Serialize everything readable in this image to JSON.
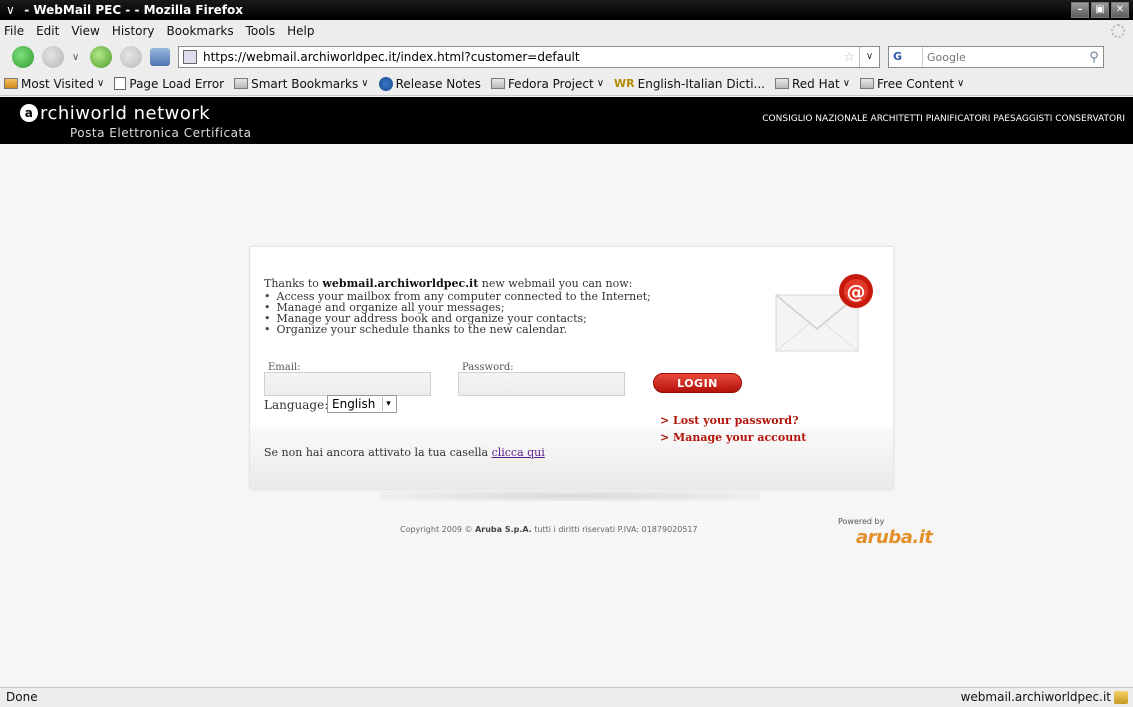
{
  "window": {
    "title": "- WebMail PEC - - Mozilla Firefox",
    "menu_glyph": "∨",
    "btn_min": "–",
    "btn_max": "▣",
    "btn_close": "✕"
  },
  "menubar": {
    "items": [
      "File",
      "Edit",
      "View",
      "History",
      "Bookmarks",
      "Tools",
      "Help"
    ]
  },
  "navbar": {
    "url": "https://webmail.archiworldpec.it/index.html?customer=default",
    "search_engine": "G",
    "search_placeholder": "Google",
    "drop_glyph": "∨",
    "star_glyph": "☆",
    "search_glyph": "⚲"
  },
  "bookmarks": {
    "items": [
      "Most Visited",
      "Page Load Error",
      "Smart Bookmarks",
      "Release Notes",
      "Fedora Project",
      "English-Italian Dicti...",
      "Red Hat",
      "Free Content"
    ],
    "chevron": "∨",
    "wr_glyph": "WR"
  },
  "header": {
    "logo_mark": "a",
    "logo_text": "rchiworld network",
    "tagline": "Posta Elettronica Certificata",
    "council": "CONSIGLIO NAZIONALE ARCHITETTI PIANIFICATORI PAESAGGISTI CONSERVATORI"
  },
  "login": {
    "intro_pre": "Thanks to ",
    "intro_site": "webmail.archiworldpec.it",
    "intro_post": " new webmail you can now:",
    "features": [
      "Access your mailbox from any computer connected to the Internet;",
      "Manage and organize all your messages;",
      "Manage your address book and organize your contacts;",
      "Organize your schedule thanks to the new calendar."
    ],
    "email_label": "Email:",
    "email_value": "",
    "password_label": "Password:",
    "password_value": "",
    "login_button": "LOGIN",
    "language_label": "Language:",
    "language_value": "English",
    "select_arrow": "▾",
    "lost_password": "> Lost your password?",
    "manage_account": "> Manage your account",
    "activate_text": "Se non hai ancora attivato la tua casella ",
    "activate_link": "clicca qui",
    "envelope_badge": "@"
  },
  "footer": {
    "copyright_pre": "Copyright 2009 © ",
    "copyright_company": "Aruba S.p.A.",
    "copyright_post": "  tutti i diritti riservati   P.IVA: 01879020517",
    "powered_by": "Powered by",
    "aruba_logo": "aruba.it"
  },
  "statusbar": {
    "status": "Done",
    "host": "webmail.archiworldpec.it"
  },
  "colors": {
    "login_red": "#c8190f",
    "link_red": "#b0140b",
    "header_black": "#000000",
    "aruba_orange": "#e4902a"
  }
}
